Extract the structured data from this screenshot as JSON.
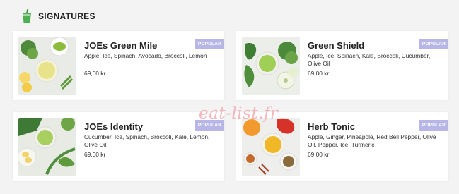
{
  "section": {
    "title": "SIGNATURES",
    "icon": "smoothie-cup-icon"
  },
  "cards": [
    {
      "name": "JOEs Green Mile",
      "ingredients": "Apple, Ice, Spinach, Avocado, Broccoli, Lemon",
      "price": "69,00 kr",
      "badge": "POPULAR"
    },
    {
      "name": "Green Shield",
      "ingredients": "Apple, Ice, Spinach, Kale, Broccoli, Cucumber, Olive Oil",
      "price": "69,00 kr",
      "badge": "POPULAR"
    },
    {
      "name": "JOEs Identity",
      "ingredients": "Cucumber, Ice, Spinach, Broccoli, Kale, Lemon, Olive Oil",
      "price": "69,00 kr",
      "badge": "POPULAR"
    },
    {
      "name": "Herb Tonic",
      "ingredients": "Apple, Ginger, Pineapple, Red Bell Pepper, Olive Oil, Pepper, Ice, Turmeric",
      "price": "69,00 kr",
      "badge": "POPULAR"
    }
  ],
  "watermark": "eat-list.fr",
  "colors": {
    "badge": "#b7b6e6",
    "watermark": "#f2a0a8"
  }
}
